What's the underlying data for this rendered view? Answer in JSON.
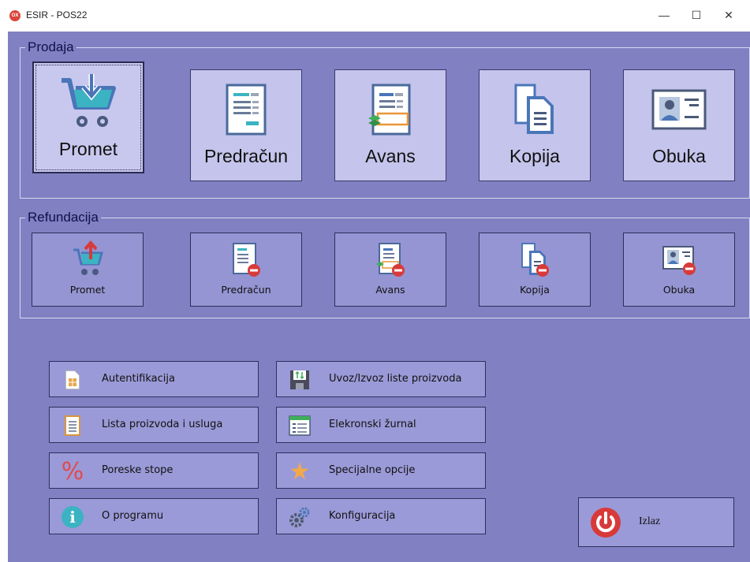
{
  "window": {
    "title": "ESIR - POS22",
    "app_icon_text": "OX",
    "minimize": "—",
    "maximize": "☐",
    "close": "✕"
  },
  "prodaja": {
    "legend": "Prodaja",
    "buttons": [
      {
        "label": "Promet",
        "icon": "cart-download-icon",
        "selected": true
      },
      {
        "label": "Predračun",
        "icon": "document-lines-icon"
      },
      {
        "label": "Avans",
        "icon": "document-advance-icon"
      },
      {
        "label": "Kopija",
        "icon": "copy-documents-icon"
      },
      {
        "label": "Obuka",
        "icon": "id-card-icon"
      }
    ]
  },
  "refundacija": {
    "legend": "Refundacija",
    "buttons": [
      {
        "label": "Promet",
        "icon": "cart-upload-icon"
      },
      {
        "label": "Predračun",
        "icon": "document-remove-icon"
      },
      {
        "label": "Avans",
        "icon": "advance-remove-icon"
      },
      {
        "label": "Kopija",
        "icon": "copy-remove-icon"
      },
      {
        "label": "Obuka",
        "icon": "id-card-remove-icon"
      }
    ]
  },
  "menu": {
    "left": [
      {
        "label": "Autentifikacija",
        "icon": "sim-card-icon"
      },
      {
        "label": "Lista proizvoda i usluga",
        "icon": "list-document-icon"
      },
      {
        "label": "Poreske stope",
        "icon": "percent-icon",
        "icon_text": "%"
      },
      {
        "label": "O programu",
        "icon": "info-icon",
        "icon_text": "i"
      }
    ],
    "right": [
      {
        "label": "Uvoz/Izvoz liste proizvoda",
        "icon": "floppy-import-icon"
      },
      {
        "label": "Elekronski žurnal",
        "icon": "journal-table-icon"
      },
      {
        "label": "Specijalne opcije",
        "icon": "star-icon",
        "icon_text": "★"
      },
      {
        "label": "Konfiguracija",
        "icon": "gears-icon"
      }
    ]
  },
  "exit": {
    "label": "Izlaz",
    "icon": "power-icon"
  },
  "colors": {
    "background": "#8080c3",
    "big_button": "#c4c4ec",
    "small_button": "#9a9ad8",
    "icon_blue": "#4a76b8",
    "icon_teal": "#3bb3c3",
    "remove_red": "#d83a3a"
  }
}
